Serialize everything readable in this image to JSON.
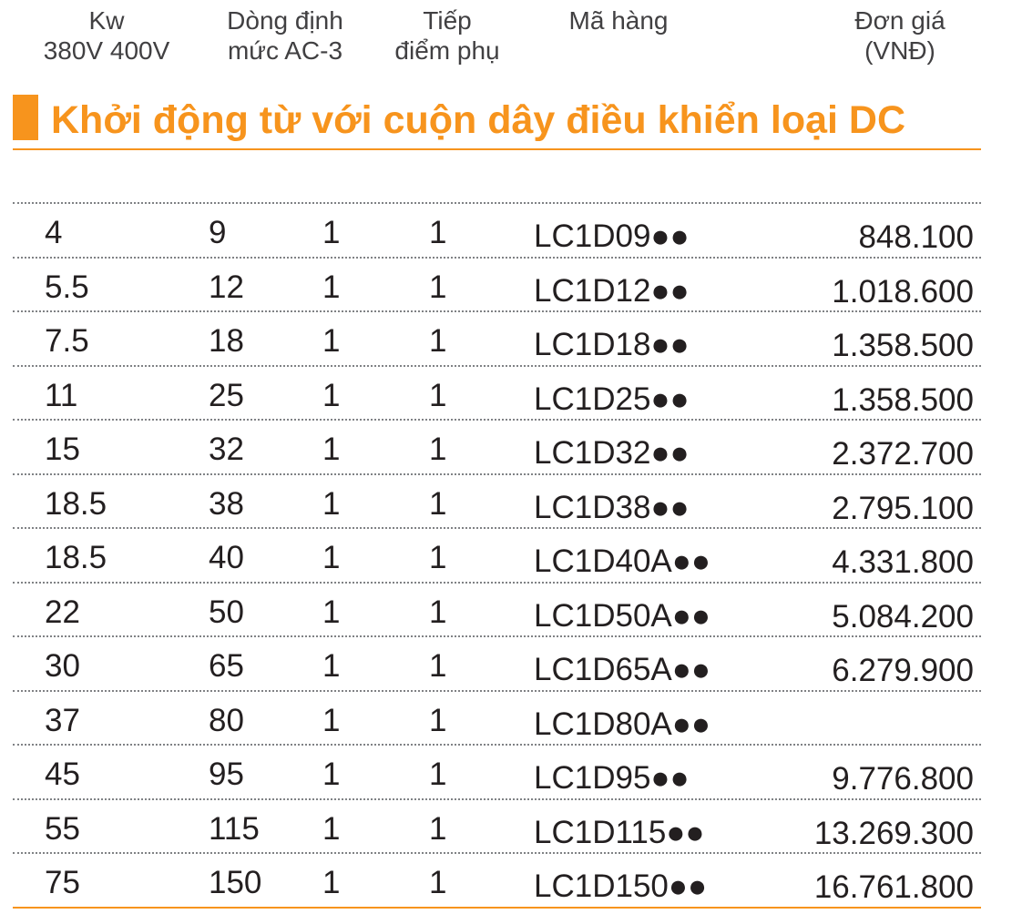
{
  "headers": {
    "kw": [
      "Kw",
      "380V 400V"
    ],
    "dong": [
      "Dòng định",
      "mức AC-3"
    ],
    "tiep": [
      "Tiếp",
      "điểm phụ"
    ],
    "ma": [
      "Mã hàng"
    ],
    "dongia": [
      "Đơn giá",
      "(VNĐ)"
    ]
  },
  "title": "Khởi động từ với cuộn dây điều khiển loại DC",
  "colors": {
    "accent": "#f7941d",
    "text": "#231f20",
    "header_text": "#414042"
  },
  "rows": [
    {
      "kw": "4",
      "amp": "9",
      "c1": "1",
      "c2": "1",
      "code": "LC1D09●●",
      "price": "848.100"
    },
    {
      "kw": "5.5",
      "amp": "12",
      "c1": "1",
      "c2": "1",
      "code": "LC1D12●●",
      "price": "1.018.600"
    },
    {
      "kw": "7.5",
      "amp": "18",
      "c1": "1",
      "c2": "1",
      "code": "LC1D18●●",
      "price": "1.358.500"
    },
    {
      "kw": "11",
      "amp": "25",
      "c1": "1",
      "c2": "1",
      "code": "LC1D25●●",
      "price": "1.358.500"
    },
    {
      "kw": "15",
      "amp": "32",
      "c1": "1",
      "c2": "1",
      "code": "LC1D32●●",
      "price": "2.372.700"
    },
    {
      "kw": "18.5",
      "amp": "38",
      "c1": "1",
      "c2": "1",
      "code": "LC1D38●●",
      "price": "2.795.100"
    },
    {
      "kw": "18.5",
      "amp": "40",
      "c1": "1",
      "c2": "1",
      "code": "LC1D40A●●",
      "price": "4.331.800"
    },
    {
      "kw": "22",
      "amp": "50",
      "c1": "1",
      "c2": "1",
      "code": "LC1D50A●●",
      "price": "5.084.200"
    },
    {
      "kw": "30",
      "amp": "65",
      "c1": "1",
      "c2": "1",
      "code": "LC1D65A●●",
      "price": "6.279.900"
    },
    {
      "kw": "37",
      "amp": "80",
      "c1": "1",
      "c2": "1",
      "code": "LC1D80A●●",
      "price": ""
    },
    {
      "kw": "45",
      "amp": "95",
      "c1": "1",
      "c2": "1",
      "code": "LC1D95●●",
      "price": "9.776.800"
    },
    {
      "kw": "55",
      "amp": "115",
      "c1": "1",
      "c2": "1",
      "code": "LC1D115●●",
      "price": "13.269.300"
    },
    {
      "kw": "75",
      "amp": "150",
      "c1": "1",
      "c2": "1",
      "code": "LC1D150●●",
      "price": "16.761.800"
    }
  ]
}
